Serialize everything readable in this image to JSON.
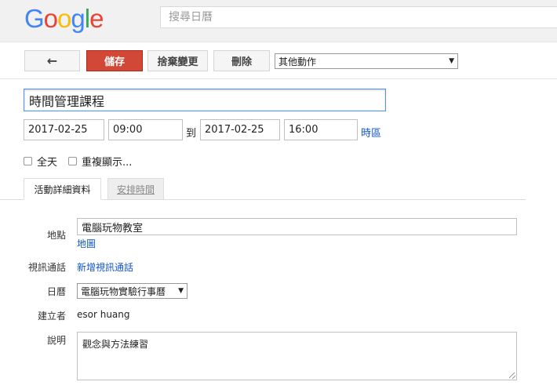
{
  "header": {
    "logo_letters": [
      {
        "ch": "G",
        "color": "#4285F4"
      },
      {
        "ch": "o",
        "color": "#EA4335"
      },
      {
        "ch": "o",
        "color": "#FBBC05"
      },
      {
        "ch": "g",
        "color": "#4285F4"
      },
      {
        "ch": "l",
        "color": "#34A853"
      },
      {
        "ch": "e",
        "color": "#EA4335"
      }
    ],
    "search_placeholder": "搜尋日曆"
  },
  "toolbar": {
    "back_icon": "←",
    "save": "儲存",
    "discard": "捨棄變更",
    "delete": "刪除",
    "more_actions": "其他動作"
  },
  "event": {
    "title": "時間管理課程",
    "start_date": "2017-02-25",
    "start_time": "09:00",
    "to": "到",
    "end_date": "2017-02-25",
    "end_time": "16:00",
    "timezone_link": "時區",
    "all_day": "全天",
    "repeat": "重複顯示..."
  },
  "tabs": {
    "details": "活動詳細資料",
    "schedule": "安排時間"
  },
  "details": {
    "location_label": "地點",
    "location_value": "電腦玩物教室",
    "map_link": "地圖",
    "video_label": "視訊通話",
    "video_link": "新增視訊通話",
    "calendar_label": "日曆",
    "calendar_value": "電腦玩物實驗行事曆",
    "creator_label": "建立者",
    "creator_value": "esor huang",
    "description_label": "說明",
    "description_value": "觀念與方法練習"
  },
  "colors": {
    "save_red": "#d14836",
    "focus_blue": "#4d90fe",
    "link_blue": "#1155cc"
  }
}
